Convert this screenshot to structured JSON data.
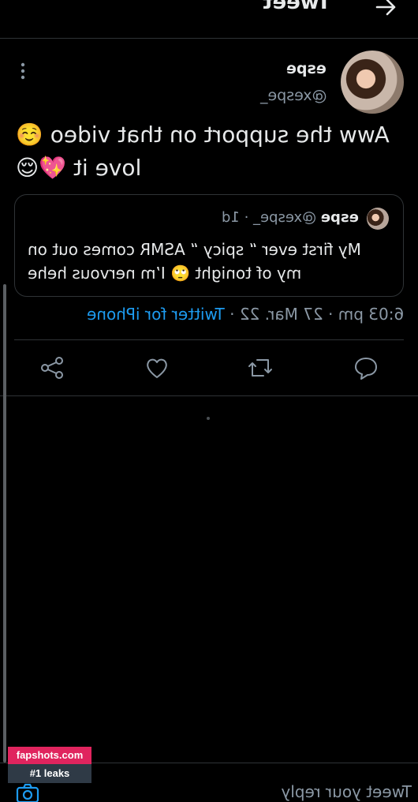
{
  "header": {
    "title": "Tweet"
  },
  "tweet": {
    "author_name": "espe",
    "author_handle": "@xespe_",
    "text_line1": "Aww the support on that video ☺️",
    "text_line2": "love it 💖😌",
    "quote": {
      "author_name": "espe",
      "meta": "@xespe_ · 1d",
      "text": "My first ever “ spicy “ ASMR comes out on my of tonight 🙄 I’m nervous hehe"
    },
    "time": "6:03 pm · 27 Mar. 22 · ",
    "source": "Twitter for iPhone"
  },
  "reply": {
    "placeholder": "Tweet your reply"
  },
  "watermark": {
    "line1": "fapshots.com",
    "line2": "#1 leaks"
  },
  "colors": {
    "background": "#000000",
    "link": "#1d9bf0",
    "muted": "#8b98a5",
    "divider": "#2f3336"
  },
  "icons": [
    "back-arrow-icon",
    "more-icon",
    "reply-icon",
    "retweet-icon",
    "like-icon",
    "share-icon",
    "camera-icon"
  ]
}
